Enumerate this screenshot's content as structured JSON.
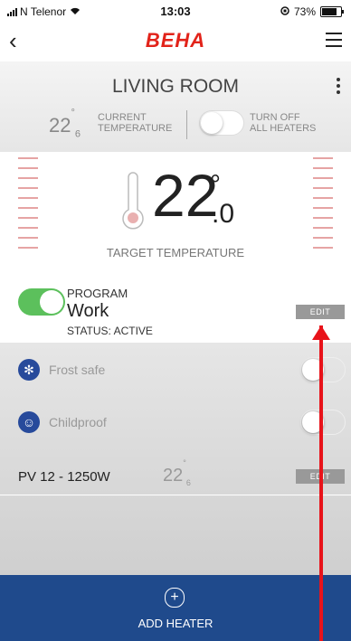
{
  "status_bar": {
    "carrier": "N Telenor",
    "time": "13:03",
    "battery": "73%"
  },
  "nav": {
    "logo": "BEHA"
  },
  "room": {
    "title": "LIVING ROOM",
    "current_temp": "22",
    "current_temp_decimal": "6",
    "current_label_1": "CURRENT",
    "current_label_2": "TEMPERATURE",
    "off_label_1": "TURN OFF",
    "off_label_2": "ALL HEATERS"
  },
  "target": {
    "value": "22",
    "decimal": ".0",
    "label": "TARGET TEMPERATURE"
  },
  "program": {
    "label": "PROGRAM",
    "name": "Work",
    "status": "STATUS: ACTIVE",
    "edit": "EDIT",
    "enabled": true
  },
  "options": [
    {
      "label": "Frost safe",
      "icon": "snowflake-icon",
      "enabled": false
    },
    {
      "label": "Childproof",
      "icon": "child-lock-icon",
      "enabled": false
    }
  ],
  "heater": {
    "name": "PV 12 - 1250W",
    "temp": "22",
    "temp_decimal": "6",
    "edit": "EDIT"
  },
  "add_heater": {
    "label": "ADD HEATER"
  },
  "colors": {
    "brand": "#e2231a",
    "accent": "#1f4a8c",
    "toggle_on": "#5cc05c",
    "annotation": "#e8131a"
  }
}
